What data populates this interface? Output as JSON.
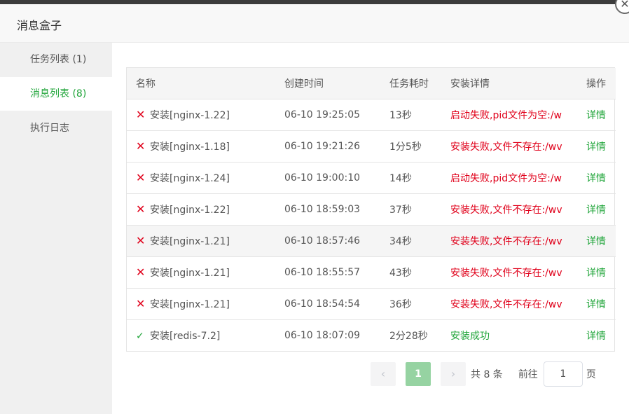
{
  "window": {
    "title": "消息盒子",
    "close_glyph": "✕"
  },
  "sidebar": {
    "items": [
      {
        "label": "任务列表 (1)",
        "active": false
      },
      {
        "label": "消息列表 (8)",
        "active": true
      },
      {
        "label": "执行日志",
        "active": false
      }
    ]
  },
  "table": {
    "columns": [
      "名称",
      "创建时间",
      "任务耗时",
      "安装详情",
      "操作"
    ],
    "rows": [
      {
        "status": "fail",
        "name": "安装[nginx-1.22]",
        "time": "06-10 19:25:05",
        "duration": "13秒",
        "detail": "启动失败,pid文件为空:/w",
        "action": "详情"
      },
      {
        "status": "fail",
        "name": "安装[nginx-1.18]",
        "time": "06-10 19:21:26",
        "duration": "1分5秒",
        "detail": "安装失败,文件不存在:/wv",
        "action": "详情"
      },
      {
        "status": "fail",
        "name": "安装[nginx-1.24]",
        "time": "06-10 19:00:10",
        "duration": "14秒",
        "detail": "启动失败,pid文件为空:/w",
        "action": "详情"
      },
      {
        "status": "fail",
        "name": "安装[nginx-1.22]",
        "time": "06-10 18:59:03",
        "duration": "37秒",
        "detail": "安装失败,文件不存在:/wv",
        "action": "详情"
      },
      {
        "status": "fail",
        "name": "安装[nginx-1.21]",
        "time": "06-10 18:57:46",
        "duration": "34秒",
        "detail": "安装失败,文件不存在:/wv",
        "action": "详情"
      },
      {
        "status": "fail",
        "name": "安装[nginx-1.21]",
        "time": "06-10 18:55:57",
        "duration": "43秒",
        "detail": "安装失败,文件不存在:/wv",
        "action": "详情"
      },
      {
        "status": "fail",
        "name": "安装[nginx-1.21]",
        "time": "06-10 18:54:54",
        "duration": "36秒",
        "detail": "安装失败,文件不存在:/wv",
        "action": "详情"
      },
      {
        "status": "ok",
        "name": "安装[redis-7.2]",
        "time": "06-10 18:07:09",
        "duration": "2分28秒",
        "detail": "安装成功",
        "action": "详情"
      }
    ],
    "fail_icon": "✕",
    "ok_icon": "✓"
  },
  "pagination": {
    "prev": "‹",
    "current_page": "1",
    "next": "›",
    "total": "共 8 条",
    "goto_label": "前往",
    "goto_value": "1",
    "unit": "页"
  },
  "colors": {
    "accent": "#20a53a",
    "error": "#e0001a",
    "active_page": "#96d3a2"
  }
}
